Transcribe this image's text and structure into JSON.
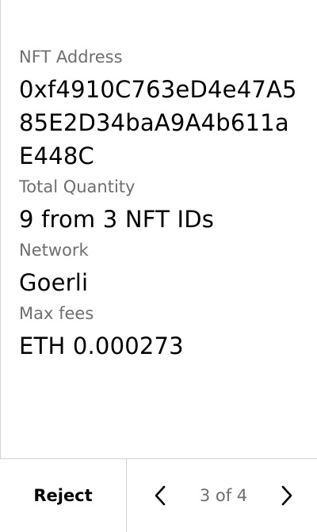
{
  "details": {
    "nft_address_label": "NFT Address",
    "nft_address_value": "0xf4910C763eD4e47A585E2D34baA9A4b611aE448C",
    "total_quantity_label": "Total Quantity",
    "total_quantity_value": "9 from 3 NFT IDs",
    "network_label": "Network",
    "network_value": "Goerli",
    "max_fees_label": "Max fees",
    "max_fees_value": "ETH 0.000273"
  },
  "footer": {
    "reject_label": "Reject",
    "page_indicator": "3 of 4",
    "prev_icon": "chevron-left-icon",
    "next_icon": "chevron-right-icon"
  },
  "colors": {
    "text_primary": "#000000",
    "text_secondary": "#6f6f6f",
    "divider": "#d4d4d4",
    "background": "#ffffff"
  }
}
